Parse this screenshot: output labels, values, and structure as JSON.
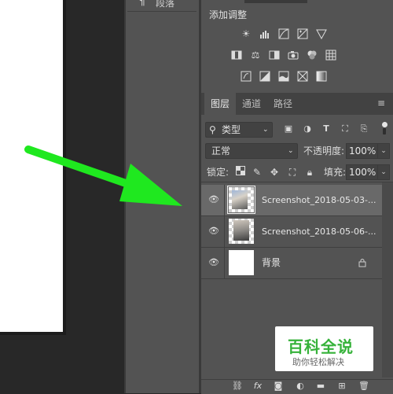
{
  "paragraph_panel": {
    "icon": "¶",
    "label": "段落"
  },
  "adjustments": {
    "title": "添加调整",
    "rows": [
      [
        "brightness-icon",
        "levels-icon",
        "curves-icon",
        "exposure-icon",
        "vibrance-icon"
      ],
      [
        "hsl-icon",
        "color-balance-icon",
        "black-white-icon",
        "photo-filter-icon",
        "channel-mixer-icon",
        "color-lookup-icon"
      ],
      [
        "invert-icon",
        "posterize-icon",
        "threshold-icon",
        "selective-color-icon",
        "gradient-map-icon"
      ]
    ]
  },
  "tabs": [
    {
      "label": "图层",
      "active": true
    },
    {
      "label": "通道",
      "active": false
    },
    {
      "label": "路径",
      "active": false
    }
  ],
  "filter": {
    "label": "类型"
  },
  "blend": {
    "mode": "正常",
    "opacity_label": "不透明度:",
    "opacity_value": "100%"
  },
  "lock": {
    "label": "锁定:",
    "fill_label": "填充:",
    "fill_value": "100%"
  },
  "layers": [
    {
      "name": "Screenshot_2018-05-03-...",
      "visible": true,
      "selected": true
    },
    {
      "name": "Screenshot_2018-05-06-...",
      "visible": true,
      "selected": false
    },
    {
      "name": "背景",
      "visible": true,
      "selected": false,
      "locked": true
    }
  ],
  "watermark": {
    "title": "百科全说",
    "subtitle": "助你轻松解决"
  },
  "colors": {
    "panel": "#535353",
    "selected_row": "#696969",
    "arrow": "#1fe81f",
    "watermark_green": "#36b23a"
  }
}
